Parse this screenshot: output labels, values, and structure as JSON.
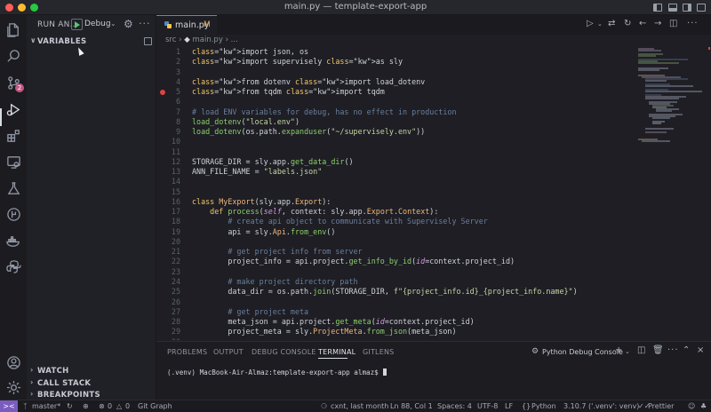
{
  "window": {
    "title": "main.py — template-export-app"
  },
  "sidebar": {
    "run_title": "RUN AN...",
    "config": "Debug",
    "sections": {
      "variables": "VARIABLES",
      "watch": "WATCH",
      "call_stack": "CALL STACK",
      "breakpoints": "BREAKPOINTS"
    }
  },
  "activity": {
    "scm_badge": "2"
  },
  "editor": {
    "tab": {
      "label": "main.py",
      "modified": "M"
    },
    "breadcrumb": {
      "folder": "src",
      "file": "main.py",
      "more": "..."
    },
    "code": [
      {
        "n": "1",
        "t": "import json, os"
      },
      {
        "n": "2",
        "t": "import supervisely as sly"
      },
      {
        "n": "3",
        "t": ""
      },
      {
        "n": "4",
        "t": "from dotenv import load_dotenv"
      },
      {
        "n": "5",
        "t": "from tqdm import tqdm"
      },
      {
        "n": "6",
        "t": ""
      },
      {
        "n": "7",
        "t": "# load ENV variables for debug, has no effect in production"
      },
      {
        "n": "8",
        "t": "load_dotenv(\"local.env\")"
      },
      {
        "n": "9",
        "t": "load_dotenv(os.path.expanduser(\"~/supervisely.env\"))"
      },
      {
        "n": "10",
        "t": ""
      },
      {
        "n": "11",
        "t": ""
      },
      {
        "n": "12",
        "t": "STORAGE_DIR = sly.app.get_data_dir()"
      },
      {
        "n": "13",
        "t": "ANN_FILE_NAME = \"labels.json\""
      },
      {
        "n": "14",
        "t": ""
      },
      {
        "n": "15",
        "t": ""
      },
      {
        "n": "16",
        "t": "class MyExport(sly.app.Export):"
      },
      {
        "n": "17",
        "t": "    def process(self, context: sly.app.Export.Context):"
      },
      {
        "n": "18",
        "t": "        # create api object to communicate with Supervisely Server"
      },
      {
        "n": "19",
        "t": "        api = sly.Api.from_env()"
      },
      {
        "n": "20",
        "t": ""
      },
      {
        "n": "21",
        "t": "        # get project info from server"
      },
      {
        "n": "22",
        "t": "        project_info = api.project.get_info_by_id(id=context.project_id)"
      },
      {
        "n": "23",
        "t": ""
      },
      {
        "n": "24",
        "t": "        # make project directory path"
      },
      {
        "n": "25",
        "t": "        data_dir = os.path.join(STORAGE_DIR, f\"{project_info.id}_{project_info.name}\")"
      },
      {
        "n": "26",
        "t": ""
      },
      {
        "n": "27",
        "t": "        # get project meta"
      },
      {
        "n": "28",
        "t": "        meta_json = api.project.get_meta(id=context.project_id)"
      },
      {
        "n": "29",
        "t": "        project_meta = sly.ProjectMeta.from_json(meta_json)"
      },
      {
        "n": "30",
        "t": ""
      }
    ],
    "breakpoint_line": "5"
  },
  "panel": {
    "tabs": [
      "PROBLEMS",
      "OUTPUT",
      "DEBUG CONSOLE",
      "TERMINAL",
      "GITLENS"
    ],
    "active_tab": "TERMINAL",
    "console_label": "Python Debug Console",
    "terminal_prompt": "(.venv) MacBook-Air-Almaz:template-export-app almaz$ "
  },
  "status": {
    "remote": "><",
    "branch": "master*",
    "errors": "0",
    "warnings": "0",
    "git_graph": "Git Graph",
    "blame": "cxnt, last month",
    "position": "Ln 88, Col 1",
    "spaces": "Spaces: 4",
    "encoding": "UTF-8",
    "eol": "LF",
    "language": "Python",
    "interpreter": "3.10.7 ('.venv': venv)",
    "formatter": "Prettier"
  },
  "colors": {
    "accent": "#4e8dd6",
    "breakpoint": "#e0443e",
    "remote": "#7a5cc0",
    "badge": "#c05a86"
  }
}
